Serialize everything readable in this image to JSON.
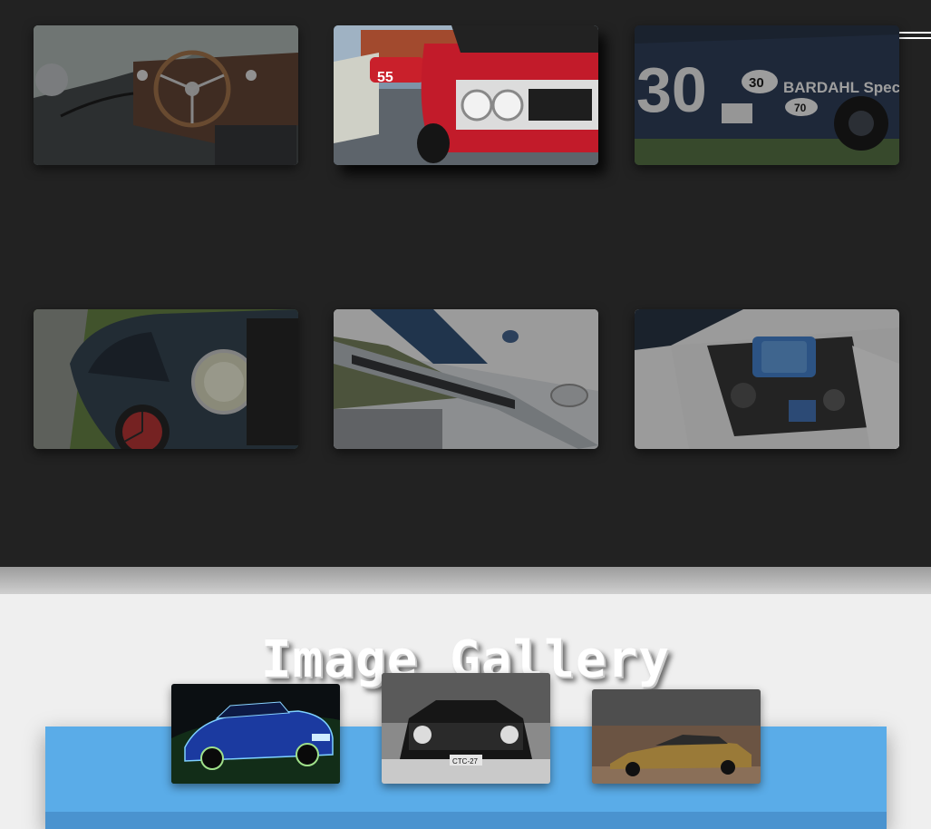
{
  "header": {
    "menu_icon": "hamburger-menu-icon"
  },
  "photo_grid": {
    "items": [
      {
        "name": "tile-interior-steering-wheel",
        "alt": "Vintage roadster interior with wooden steering wheel"
      },
      {
        "name": "tile-red-car-front",
        "alt": "Red classic car front with open hood"
      },
      {
        "name": "tile-race-car-30",
        "alt": "Blue race car number 30 Bardahl Special"
      },
      {
        "name": "tile-vintage-headlamp",
        "alt": "Vintage car fender and headlamp"
      },
      {
        "name": "tile-white-car-bumper",
        "alt": "White car front bumper with blue stripes"
      },
      {
        "name": "tile-engine-bay",
        "alt": "White car open engine bay"
      }
    ],
    "overlay_text": {
      "race_number": "30",
      "race_number_small": "30",
      "race_number_small_2": "70",
      "race_sponsor": "BARDAHL Spec",
      "red_car_number": "55"
    }
  },
  "gallery": {
    "title": "Image Gallery",
    "thumbnails": [
      {
        "alt": "Blue Mustang fractal art"
      },
      {
        "alt": "Black and white Camaro front"
      },
      {
        "alt": "Gold classic car in field"
      }
    ],
    "plate_text": "CTC-27"
  },
  "colors": {
    "dark_bg": "#222222",
    "light_bg": "#efefef",
    "panel_blue": "#5aace8",
    "panel_blue_dark": "#4a93cf"
  }
}
